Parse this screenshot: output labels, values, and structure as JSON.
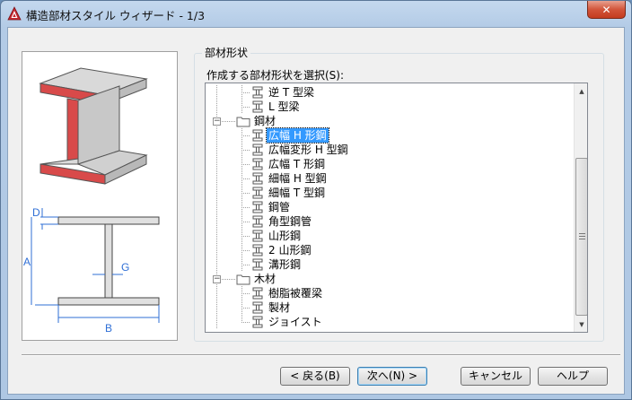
{
  "window": {
    "title": "構造部材スタイル ウィザード - 1/3",
    "close_glyph": "✕"
  },
  "group": {
    "title": "部材形状",
    "tree_label": "作成する部材形状を選択(S):"
  },
  "tree": [
    {
      "label": "逆 T 型梁",
      "level": 2,
      "expander": "",
      "icon": "member-icon"
    },
    {
      "label": "L 型梁",
      "level": 2,
      "expander": "",
      "icon": "member-icon"
    },
    {
      "label": "鋼材",
      "level": 1,
      "expander": "−",
      "icon": "folder-icon"
    },
    {
      "label": "広幅 H 形鋼",
      "level": 2,
      "expander": "",
      "icon": "member-icon",
      "selected": true
    },
    {
      "label": "広幅変形 H 型鋼",
      "level": 2,
      "expander": "",
      "icon": "member-icon"
    },
    {
      "label": "広幅 T 形鋼",
      "level": 2,
      "expander": "",
      "icon": "member-icon"
    },
    {
      "label": "細幅 H 型鋼",
      "level": 2,
      "expander": "",
      "icon": "member-icon"
    },
    {
      "label": "細幅 T 型鋼",
      "level": 2,
      "expander": "",
      "icon": "member-icon"
    },
    {
      "label": "鋼管",
      "level": 2,
      "expander": "",
      "icon": "member-icon"
    },
    {
      "label": "角型鋼管",
      "level": 2,
      "expander": "",
      "icon": "member-icon"
    },
    {
      "label": "山形鋼",
      "level": 2,
      "expander": "",
      "icon": "member-icon"
    },
    {
      "label": "2 山形鋼",
      "level": 2,
      "expander": "",
      "icon": "member-icon"
    },
    {
      "label": "溝形鋼",
      "level": 2,
      "expander": "",
      "icon": "member-icon"
    },
    {
      "label": "木材",
      "level": 1,
      "expander": "−",
      "icon": "folder-icon"
    },
    {
      "label": "樹脂被覆梁",
      "level": 2,
      "expander": "",
      "icon": "member-icon"
    },
    {
      "label": "製材",
      "level": 2,
      "expander": "",
      "icon": "member-icon"
    },
    {
      "label": "ジョイスト",
      "level": 2,
      "expander": "",
      "icon": "member-icon"
    }
  ],
  "preview": {
    "dim_labels": {
      "d": "D",
      "a": "A",
      "g": "G",
      "b": "B"
    }
  },
  "buttons": {
    "back": "< 戻る(B)",
    "next": "次へ(N) >",
    "cancel": "キャンセル",
    "help": "ヘルプ"
  },
  "colors": {
    "flange_red": "#d84a4a",
    "selection": "#3399ff",
    "app_icon": "#c4262e"
  }
}
